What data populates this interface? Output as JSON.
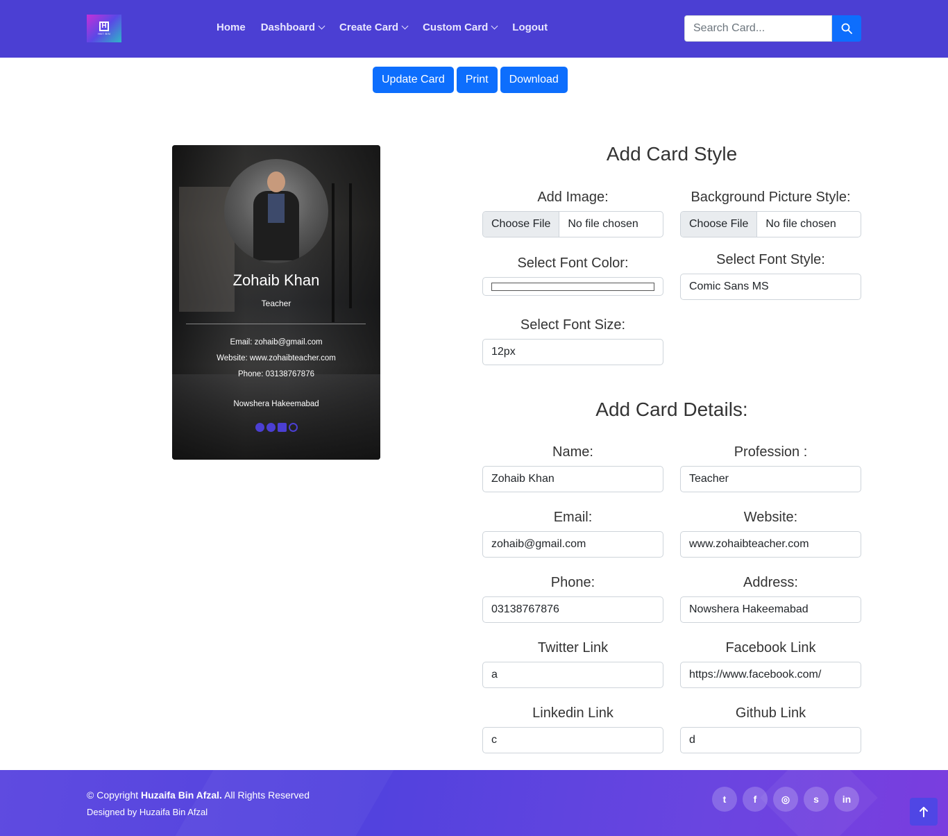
{
  "nav": {
    "logo_text": "HBT BIN",
    "links": [
      {
        "label": "Home",
        "dropdown": false
      },
      {
        "label": "Dashboard",
        "dropdown": true
      },
      {
        "label": "Create Card",
        "dropdown": true
      },
      {
        "label": "Custom Card",
        "dropdown": true
      },
      {
        "label": "Logout",
        "dropdown": false
      }
    ],
    "search_placeholder": "Search Card...",
    "search_icon": "search-icon"
  },
  "actions": {
    "update": "Update Card",
    "print": "Print",
    "download": "Download"
  },
  "card": {
    "name": "Zohaib Khan",
    "profession": "Teacher",
    "email_line": "Email: zohaib@gmail.com",
    "website_line": "Website: www.zohaibteacher.com",
    "phone_line": "Phone: 03138767876",
    "address_line": "Nowshera Hakeemabad",
    "social_icons": [
      "twitter-icon",
      "facebook-icon",
      "instagram-icon",
      "github-icon"
    ],
    "social_color": "#4b3fd3"
  },
  "style_section": {
    "title": "Add Card Style",
    "add_image_label": "Add Image:",
    "bg_picture_label": "Background Picture Style:",
    "file_button": "Choose File",
    "file_status": "No file chosen",
    "font_color_label": "Select Font Color:",
    "font_color_value": "#ffffff",
    "font_style_label": "Select Font Style:",
    "font_style_value": "Comic Sans MS",
    "font_size_label": "Select Font Size:",
    "font_size_value": "12px"
  },
  "details_section": {
    "title": "Add Card Details:",
    "name_label": "Name:",
    "name_value": "Zohaib Khan",
    "profession_label": "Profession :",
    "profession_value": "Teacher",
    "email_label": "Email:",
    "email_value": "zohaib@gmail.com",
    "website_label": "Website:",
    "website_value": "www.zohaibteacher.com",
    "phone_label": "Phone:",
    "phone_value": "03138767876",
    "address_label": "Address:",
    "address_value": "Nowshera Hakeemabad",
    "twitter_label": "Twitter Link",
    "twitter_value": "a",
    "facebook_label": "Facebook Link",
    "facebook_value": "https://www.facebook.com/",
    "linkedin_label": "Linkedin Link",
    "linkedin_value": "c",
    "github_label": "Github Link",
    "github_value": "d"
  },
  "footer": {
    "copyright_prefix": "© Copyright ",
    "copyright_owner": "Huzaifa Bin Afzal.",
    "copyright_suffix": " All Rights Reserved",
    "designed": "Designed by Huzaifa Bin Afzal",
    "social_icons": [
      "twitter-icon",
      "facebook-icon",
      "instagram-icon",
      "skype-icon",
      "linkedin-icon"
    ],
    "social_glyphs": [
      "t",
      "f",
      "◎",
      "s",
      "in"
    ]
  },
  "colors": {
    "nav_bg": "#4b3fd3",
    "primary_button": "#0d6efd",
    "footer_start": "#5f4be0",
    "footer_end": "#7a3ddf"
  }
}
